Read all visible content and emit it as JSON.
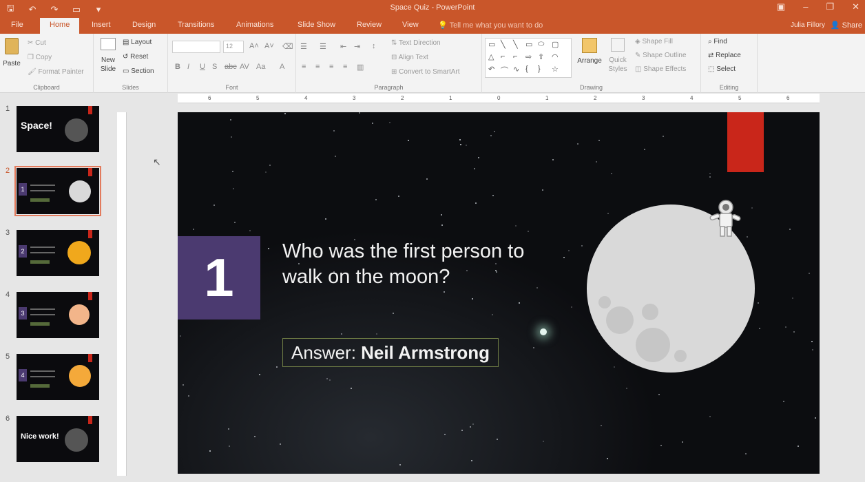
{
  "window": {
    "title": "Space Quiz - PowerPoint"
  },
  "qat": {
    "save": "🖫",
    "undo": "↶",
    "redo": "↷",
    "present": "▭",
    "more": "▾"
  },
  "winctrl": {
    "restore_ribbon": "▣",
    "minimize": "–",
    "maximize": "❐",
    "close": "✕"
  },
  "tabs": [
    "File",
    "Home",
    "Insert",
    "Design",
    "Transitions",
    "Animations",
    "Slide Show",
    "Review",
    "View"
  ],
  "tell_me": "Tell me what you want to do",
  "user": {
    "name": "Julia Fillory",
    "share": "Share"
  },
  "ribbon": {
    "clipboard": {
      "paste": "Paste",
      "cut": "Cut",
      "copy": "Copy",
      "format_painter": "Format Painter",
      "label": "Clipboard"
    },
    "slides": {
      "new_slide": "New Slide",
      "layout": "Layout",
      "reset": "Reset",
      "section": "Section",
      "label": "Slides"
    },
    "font": {
      "size": "12",
      "label": "Font"
    },
    "paragraph": {
      "text_direction": "Text Direction",
      "align_text": "Align Text",
      "convert_smartart": "Convert to SmartArt",
      "label": "Paragraph"
    },
    "drawing": {
      "arrange": "Arrange",
      "quick_styles": "Quick Styles",
      "shape_fill": "Shape Fill",
      "shape_outline": "Shape Outline",
      "shape_effects": "Shape Effects",
      "label": "Drawing"
    },
    "editing": {
      "find": "Find",
      "replace": "Replace",
      "select": "Select",
      "label": "Editing"
    }
  },
  "ruler": [
    "6",
    "5",
    "4",
    "3",
    "2",
    "1",
    "0",
    "1",
    "2",
    "3",
    "4",
    "5",
    "6"
  ],
  "thumbnails": [
    {
      "num": "1",
      "title": "Space!"
    },
    {
      "num": "2",
      "badge": "1"
    },
    {
      "num": "3",
      "badge": "2"
    },
    {
      "num": "4",
      "badge": "3"
    },
    {
      "num": "5",
      "badge": "4"
    },
    {
      "num": "6",
      "title": "Nice work!"
    }
  ],
  "slide": {
    "number": "1",
    "question": "Who was the first person to walk on the moon?",
    "answer_label": "Answer:",
    "answer_value": "Neil Armstrong"
  },
  "colors": {
    "accent": "#c9562a",
    "purple": "#4b3a70",
    "red": "#c9261a",
    "moon": "#d9d9d9"
  }
}
